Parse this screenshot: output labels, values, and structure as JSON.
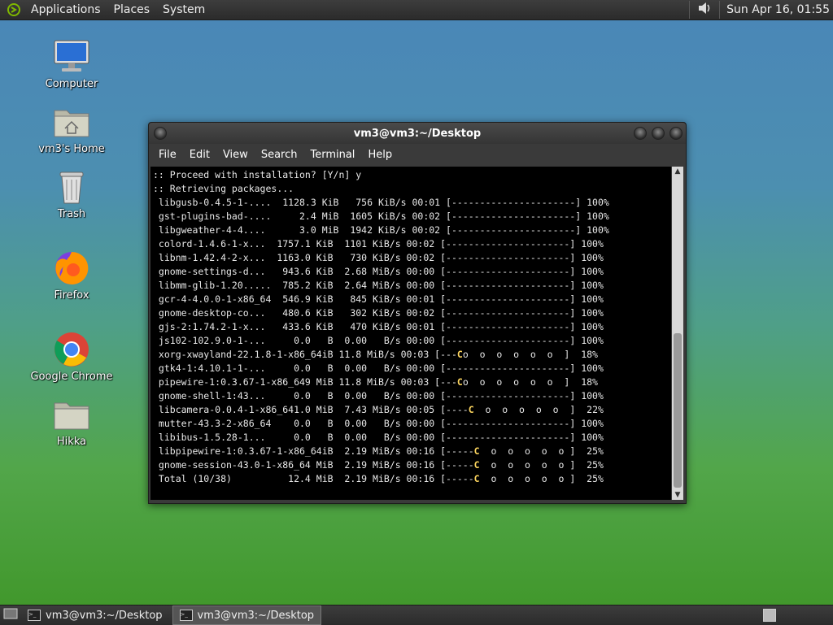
{
  "top_panel": {
    "menus": [
      "Applications",
      "Places",
      "System"
    ],
    "clock": "Sun Apr 16, 01:55"
  },
  "desktop_icons": [
    {
      "label": "Computer",
      "icon": "computer-icon"
    },
    {
      "label": "vm3's Home",
      "icon": "home-folder-icon"
    },
    {
      "label": "Trash",
      "icon": "trash-icon"
    },
    {
      "label": "Firefox",
      "icon": "firefox-icon"
    },
    {
      "label": "Google Chrome",
      "icon": "chrome-icon"
    },
    {
      "label": "Hikka",
      "icon": "folder-icon"
    }
  ],
  "terminal": {
    "title": "vm3@vm3:~/Desktop",
    "menu": [
      "File",
      "Edit",
      "View",
      "Search",
      "Terminal",
      "Help"
    ],
    "lines": [
      ":: Proceed with installation? [Y/n] y",
      ":: Retrieving packages...",
      " libgusb-0.4.5-1-....  1128.3 KiB   756 KiB/s 00:01 [----------------------] 100%",
      " gst-plugins-bad-....     2.4 MiB  1605 KiB/s 00:02 [----------------------] 100%",
      " libgweather-4-4....      3.0 MiB  1942 KiB/s 00:02 [----------------------] 100%",
      " colord-1.4.6-1-x...  1757.1 KiB  1101 KiB/s 00:02 [----------------------] 100%",
      " libnm-1.42.4-2-x...  1163.0 KiB   730 KiB/s 00:02 [----------------------] 100%",
      " gnome-settings-d...   943.6 KiB  2.68 MiB/s 00:00 [----------------------] 100%",
      " libmm-glib-1.20.....  785.2 KiB  2.64 MiB/s 00:00 [----------------------] 100%",
      " gcr-4-4.0.0-1-x86_64  546.9 KiB   845 KiB/s 00:01 [----------------------] 100%",
      " gnome-desktop-co...   480.6 KiB   302 KiB/s 00:02 [----------------------] 100%",
      " gjs-2:1.74.2-1-x...   433.6 KiB   470 KiB/s 00:01 [----------------------] 100%",
      " js102-102.9.0-1-...     0.0   B  0.00   B/s 00:00 [----------------------] 100%",
      " xorg-xwayland-22.1.8-1-x86_64iB 11.8 MiB/s 00:03 [---Co  o  o  o  o  o  ]  18%",
      " gtk4-1:4.10.1-1-...     0.0   B  0.00   B/s 00:00 [----------------------] 100%",
      " pipewire-1:0.3.67-1-x86_649 MiB 11.8 MiB/s 00:03 [---Co  o  o  o  o  o  ]  18%",
      " gnome-shell-1:43...     0.0   B  0.00   B/s 00:00 [----------------------] 100%",
      " libcamera-0.0.4-1-x86_641.0 MiB  7.43 MiB/s 00:05 [----C  o  o  o  o  o  ]  22%",
      " mutter-43.3-2-x86_64    0.0   B  0.00   B/s 00:00 [----------------------] 100%",
      " libibus-1.5.28-1...     0.0   B  0.00   B/s 00:00 [----------------------] 100%",
      " libpipewire-1:0.3.67-1-x86_64iB  2.19 MiB/s 00:16 [-----C  o  o  o  o  o ]  25%",
      " gnome-session-43.0-1-x86_64 MiB  2.19 MiB/s 00:16 [-----C  o  o  o  o  o ]  25%",
      " Total (10/38)          12.4 MiB  2.19 MiB/s 00:16 [-----C  o  o  o  o  o ]  25%"
    ]
  },
  "taskbar": {
    "tasks": [
      "vm3@vm3:~/Desktop",
      "vm3@vm3:~/Desktop"
    ]
  }
}
